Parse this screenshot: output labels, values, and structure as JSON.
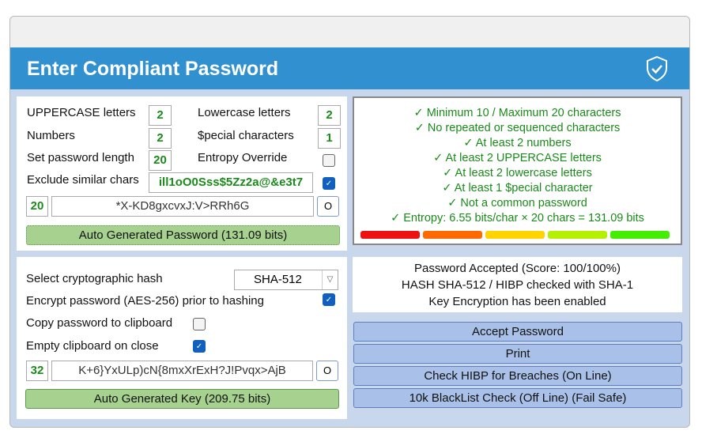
{
  "title": "Enter Compliant Password",
  "colors": {
    "header": "#3090d0",
    "accent_green": "#1a8a1a",
    "strength": [
      "#ee1111",
      "#ff6a00",
      "#ffd400",
      "#b4f000",
      "#44ee00"
    ]
  },
  "policy": {
    "uppercase_label": "UPPERCASE letters",
    "uppercase": "2",
    "lowercase_label": "Lowercase letters",
    "lowercase": "2",
    "numbers_label": "Numbers",
    "numbers": "2",
    "special_label": "$pecial characters",
    "special": "1",
    "length_label": "Set password length",
    "length": "20",
    "entropy_override_label": "Entropy Override",
    "entropy_override": false,
    "exclude_label": "Exclude similar chars",
    "exclude_chars": "ill1oO0Sss$5Zz2a@&e3t7",
    "exclude_checked": true,
    "password_length": "20",
    "password": "*X-KD8gxcvxJ:V>RRh6G",
    "refresh_label": "O",
    "generate_label": "Auto Generated Password (131.09 bits)"
  },
  "rules": [
    "✓ Minimum 10 / Maximum 20 characters",
    "✓ No repeated or sequenced characters",
    "✓ At least 2 numbers",
    "✓ At least 2 UPPERCASE letters",
    "✓ At least 2 lowercase letters",
    "✓ At least 1 $pecial character",
    "✓ Not a common password",
    "✓ Entropy: 6.55 bits/char × 20 chars = 131.09 bits"
  ],
  "strength_level": 5,
  "hash": {
    "select_label": "Select cryptographic hash",
    "selected": "SHA-512",
    "encrypt_label": "Encrypt password (AES-256) prior to hashing",
    "encrypt": true,
    "copy_label": "Copy password to clipboard",
    "copy": false,
    "empty_label": "Empty clipboard on close",
    "empty": true,
    "key_length": "32",
    "key": "K+6}YxULp)cN{8mxXrExH?J!Pvqx>AjB",
    "refresh_label": "O",
    "generate_label": "Auto Generated Key (209.75 bits)"
  },
  "status": [
    "Password Accepted (Score: 100/100%)",
    "HASH SHA-512 / HIBP checked with SHA-1",
    "Key Encryption has been enabled"
  ],
  "actions": [
    "Accept Password",
    "Print",
    "Check HIBP for Breaches (On Line)",
    "10k BlackList Check (Off Line) (Fail Safe)"
  ]
}
